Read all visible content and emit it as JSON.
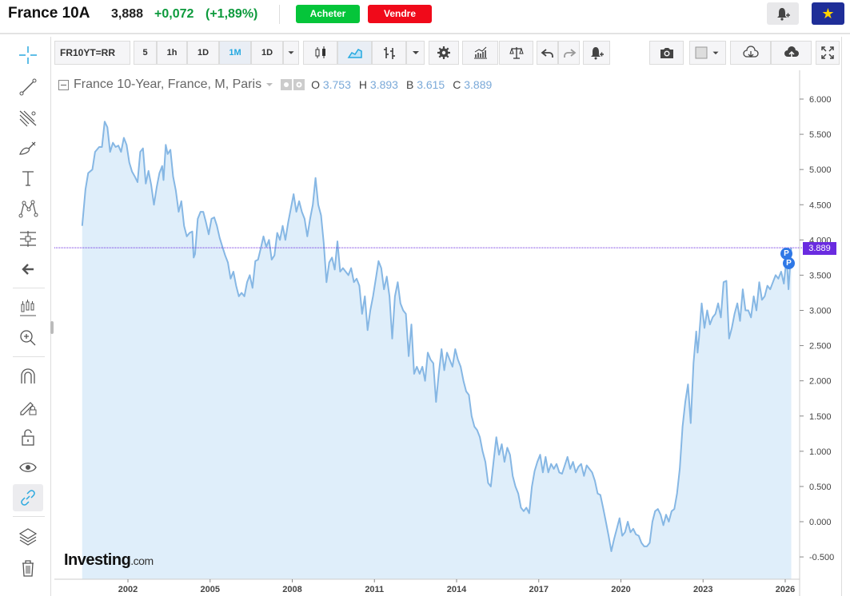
{
  "header": {
    "title": "France 10A",
    "price": "3,888",
    "change": "+0,072",
    "change_pct": "(+1,89%)",
    "buy_label": "Acheter",
    "sell_label": "Vendre",
    "colors": {
      "up": "#0c9a3c",
      "buy": "#05c53a",
      "sell": "#f00a1a",
      "watch": "#1f2e98"
    }
  },
  "left_toolbar": [
    {
      "name": "crosshair-icon",
      "active": false
    },
    {
      "name": "trend-line-icon",
      "active": false
    },
    {
      "name": "fib-tool-icon",
      "active": false
    },
    {
      "name": "brush-icon",
      "active": false
    },
    {
      "name": "text-icon",
      "active": false
    },
    {
      "name": "pattern-icon",
      "active": false
    },
    {
      "name": "measure-icon",
      "active": false
    },
    {
      "name": "back-arrow-icon",
      "active": false
    },
    {
      "name": "indicators-icon",
      "active": false
    },
    {
      "name": "zoom-in-icon",
      "active": false
    },
    {
      "name": "magnet-icon",
      "active": false
    },
    {
      "name": "lock-drawing-icon",
      "active": false
    },
    {
      "name": "unlock-icon",
      "active": false
    },
    {
      "name": "eye-icon",
      "active": false
    },
    {
      "name": "link-icon",
      "active": true
    },
    {
      "name": "layers-icon",
      "active": false
    },
    {
      "name": "trash-icon",
      "active": false
    }
  ],
  "top_toolbar": {
    "symbol": "FR10YT=RR",
    "intervals": [
      "5",
      "1h",
      "1D",
      "1M",
      "1D"
    ],
    "active_interval": "1M",
    "icons": [
      "candles-icon",
      "area-chart-icon",
      "bars-icon",
      "dropdown-icon",
      "settings-icon",
      "indicators-icon",
      "compare-icon",
      "undo-icon",
      "redo-icon",
      "alert-add-icon",
      "camera-icon",
      "color-box-icon",
      "cloud-download-icon",
      "cloud-upload-icon",
      "fullscreen-icon"
    ]
  },
  "legend": {
    "name": "France 10-Year, France, M, Paris",
    "o_label": "O",
    "o": "3.753",
    "h_label": "H",
    "h": "3.893",
    "l_label": "B",
    "l": "3.615",
    "c_label": "C",
    "c": "3.889"
  },
  "watermark": {
    "brand": "Investing",
    "suffix": ".com"
  },
  "markers": [
    "P",
    "P"
  ],
  "chart_data": {
    "type": "area",
    "title": "France 10-Year, France, M, Paris",
    "xlabel": "",
    "ylabel": "",
    "x_ticks": [
      "2002",
      "2005",
      "2008",
      "2011",
      "2014",
      "2017",
      "2020",
      "2023",
      "2026"
    ],
    "y_ticks": [
      "6.000",
      "5.500",
      "5.000",
      "4.500",
      "4.000",
      "3.500",
      "3.000",
      "2.500",
      "2.000",
      "1.500",
      "1.000",
      "0.500",
      "0.000",
      "-0.500"
    ],
    "ylim": [
      -0.8,
      6.3
    ],
    "xlim": [
      2000.3,
      2026.3
    ],
    "last_value": "3.889",
    "grid": false,
    "line_color": "#86b7e4",
    "fill_color": "#dfeefa",
    "last_line_color": "#6a2be0",
    "series": [
      {
        "values": [
          [
            2000.33,
            4.2
          ],
          [
            2000.45,
            4.72
          ],
          [
            2000.55,
            4.95
          ],
          [
            2000.7,
            5.0
          ],
          [
            2000.8,
            5.25
          ],
          [
            2000.95,
            5.32
          ],
          [
            2001.05,
            5.32
          ],
          [
            2001.15,
            5.68
          ],
          [
            2001.25,
            5.6
          ],
          [
            2001.35,
            5.25
          ],
          [
            2001.45,
            5.38
          ],
          [
            2001.55,
            5.32
          ],
          [
            2001.65,
            5.34
          ],
          [
            2001.75,
            5.25
          ],
          [
            2001.85,
            5.45
          ],
          [
            2001.95,
            5.35
          ],
          [
            2002.05,
            5.1
          ],
          [
            2002.15,
            4.97
          ],
          [
            2002.25,
            4.9
          ],
          [
            2002.35,
            4.82
          ],
          [
            2002.45,
            5.25
          ],
          [
            2002.55,
            5.3
          ],
          [
            2002.65,
            4.8
          ],
          [
            2002.75,
            4.98
          ],
          [
            2002.85,
            4.78
          ],
          [
            2002.95,
            4.5
          ],
          [
            2003.05,
            4.75
          ],
          [
            2003.15,
            4.95
          ],
          [
            2003.25,
            5.05
          ],
          [
            2003.3,
            4.85
          ],
          [
            2003.38,
            5.35
          ],
          [
            2003.45,
            5.22
          ],
          [
            2003.55,
            5.28
          ],
          [
            2003.65,
            4.9
          ],
          [
            2003.75,
            4.7
          ],
          [
            2003.85,
            4.4
          ],
          [
            2003.95,
            4.55
          ],
          [
            2004.05,
            4.2
          ],
          [
            2004.15,
            4.05
          ],
          [
            2004.25,
            4.1
          ],
          [
            2004.35,
            4.12
          ],
          [
            2004.4,
            3.75
          ],
          [
            2004.45,
            3.8
          ],
          [
            2004.55,
            4.3
          ],
          [
            2004.65,
            4.4
          ],
          [
            2004.75,
            4.4
          ],
          [
            2004.85,
            4.25
          ],
          [
            2004.95,
            4.08
          ],
          [
            2005.05,
            4.3
          ],
          [
            2005.15,
            4.32
          ],
          [
            2005.25,
            4.2
          ],
          [
            2005.35,
            4.03
          ],
          [
            2005.45,
            3.9
          ],
          [
            2005.55,
            3.78
          ],
          [
            2005.65,
            3.68
          ],
          [
            2005.75,
            3.45
          ],
          [
            2005.85,
            3.55
          ],
          [
            2005.95,
            3.35
          ],
          [
            2006.05,
            3.2
          ],
          [
            2006.15,
            3.25
          ],
          [
            2006.25,
            3.2
          ],
          [
            2006.35,
            3.4
          ],
          [
            2006.45,
            3.5
          ],
          [
            2006.55,
            3.32
          ],
          [
            2006.65,
            3.7
          ],
          [
            2006.75,
            3.72
          ],
          [
            2006.85,
            3.88
          ],
          [
            2006.95,
            4.05
          ],
          [
            2007.05,
            3.9
          ],
          [
            2007.15,
            4.0
          ],
          [
            2007.25,
            3.72
          ],
          [
            2007.35,
            3.78
          ],
          [
            2007.45,
            4.1
          ],
          [
            2007.55,
            4.0
          ],
          [
            2007.65,
            4.2
          ],
          [
            2007.75,
            4.0
          ],
          [
            2007.85,
            4.25
          ],
          [
            2007.95,
            4.45
          ],
          [
            2008.05,
            4.65
          ],
          [
            2008.15,
            4.4
          ],
          [
            2008.25,
            4.55
          ],
          [
            2008.35,
            4.4
          ],
          [
            2008.45,
            4.3
          ],
          [
            2008.55,
            4.05
          ],
          [
            2008.65,
            4.3
          ],
          [
            2008.75,
            4.5
          ],
          [
            2008.85,
            4.88
          ],
          [
            2008.95,
            4.5
          ],
          [
            2009.05,
            4.35
          ],
          [
            2009.15,
            3.95
          ],
          [
            2009.25,
            3.4
          ],
          [
            2009.35,
            3.68
          ],
          [
            2009.45,
            3.75
          ],
          [
            2009.55,
            3.58
          ],
          [
            2009.65,
            3.98
          ],
          [
            2009.75,
            3.55
          ],
          [
            2009.85,
            3.6
          ],
          [
            2009.95,
            3.55
          ],
          [
            2010.05,
            3.5
          ],
          [
            2010.15,
            3.6
          ],
          [
            2010.25,
            3.4
          ],
          [
            2010.35,
            3.45
          ],
          [
            2010.45,
            3.35
          ],
          [
            2010.55,
            2.95
          ],
          [
            2010.65,
            3.2
          ],
          [
            2010.75,
            2.72
          ],
          [
            2010.85,
            3.0
          ],
          [
            2010.95,
            3.2
          ],
          [
            2011.05,
            3.45
          ],
          [
            2011.15,
            3.7
          ],
          [
            2011.25,
            3.6
          ],
          [
            2011.35,
            3.3
          ],
          [
            2011.45,
            3.48
          ],
          [
            2011.55,
            3.2
          ],
          [
            2011.65,
            2.6
          ],
          [
            2011.75,
            3.2
          ],
          [
            2011.85,
            3.4
          ],
          [
            2011.95,
            3.1
          ],
          [
            2012.05,
            3.0
          ],
          [
            2012.15,
            2.95
          ],
          [
            2012.25,
            2.35
          ],
          [
            2012.35,
            2.8
          ],
          [
            2012.45,
            2.1
          ],
          [
            2012.55,
            2.2
          ],
          [
            2012.65,
            2.1
          ],
          [
            2012.75,
            2.2
          ],
          [
            2012.85,
            2.0
          ],
          [
            2012.95,
            2.4
          ],
          [
            2013.05,
            2.3
          ],
          [
            2013.15,
            2.25
          ],
          [
            2013.25,
            1.7
          ],
          [
            2013.35,
            2.1
          ],
          [
            2013.45,
            2.45
          ],
          [
            2013.55,
            2.15
          ],
          [
            2013.65,
            2.4
          ],
          [
            2013.75,
            2.3
          ],
          [
            2013.85,
            2.2
          ],
          [
            2013.95,
            2.45
          ],
          [
            2014.05,
            2.3
          ],
          [
            2014.15,
            2.2
          ],
          [
            2014.25,
            2.0
          ],
          [
            2014.35,
            1.85
          ],
          [
            2014.45,
            1.8
          ],
          [
            2014.55,
            1.5
          ],
          [
            2014.65,
            1.35
          ],
          [
            2014.75,
            1.3
          ],
          [
            2014.85,
            1.2
          ],
          [
            2014.95,
            1.0
          ],
          [
            2015.05,
            0.85
          ],
          [
            2015.15,
            0.55
          ],
          [
            2015.25,
            0.5
          ],
          [
            2015.35,
            0.85
          ],
          [
            2015.45,
            1.2
          ],
          [
            2015.55,
            0.95
          ],
          [
            2015.65,
            1.1
          ],
          [
            2015.75,
            0.85
          ],
          [
            2015.85,
            1.05
          ],
          [
            2015.95,
            0.95
          ],
          [
            2016.05,
            0.65
          ],
          [
            2016.15,
            0.5
          ],
          [
            2016.25,
            0.4
          ],
          [
            2016.35,
            0.2
          ],
          [
            2016.45,
            0.15
          ],
          [
            2016.55,
            0.2
          ],
          [
            2016.65,
            0.12
          ],
          [
            2016.75,
            0.5
          ],
          [
            2016.85,
            0.72
          ],
          [
            2016.95,
            0.85
          ],
          [
            2017.05,
            0.95
          ],
          [
            2017.15,
            0.7
          ],
          [
            2017.25,
            0.92
          ],
          [
            2017.35,
            0.7
          ],
          [
            2017.45,
            0.82
          ],
          [
            2017.55,
            0.75
          ],
          [
            2017.65,
            0.82
          ],
          [
            2017.75,
            0.7
          ],
          [
            2017.85,
            0.68
          ],
          [
            2017.95,
            0.8
          ],
          [
            2018.05,
            0.92
          ],
          [
            2018.15,
            0.75
          ],
          [
            2018.25,
            0.85
          ],
          [
            2018.35,
            0.7
          ],
          [
            2018.45,
            0.78
          ],
          [
            2018.55,
            0.82
          ],
          [
            2018.65,
            0.65
          ],
          [
            2018.75,
            0.8
          ],
          [
            2018.85,
            0.75
          ],
          [
            2018.95,
            0.7
          ],
          [
            2019.05,
            0.58
          ],
          [
            2019.15,
            0.4
          ],
          [
            2019.25,
            0.38
          ],
          [
            2019.35,
            0.2
          ],
          [
            2019.45,
            0.0
          ],
          [
            2019.55,
            -0.2
          ],
          [
            2019.65,
            -0.42
          ],
          [
            2019.75,
            -0.25
          ],
          [
            2019.85,
            -0.1
          ],
          [
            2019.95,
            0.05
          ],
          [
            2020.05,
            -0.2
          ],
          [
            2020.15,
            -0.15
          ],
          [
            2020.25,
            0.0
          ],
          [
            2020.35,
            -0.15
          ],
          [
            2020.45,
            -0.1
          ],
          [
            2020.55,
            -0.18
          ],
          [
            2020.65,
            -0.2
          ],
          [
            2020.75,
            -0.3
          ],
          [
            2020.85,
            -0.35
          ],
          [
            2020.95,
            -0.35
          ],
          [
            2021.05,
            -0.3
          ],
          [
            2021.15,
            0.0
          ],
          [
            2021.25,
            0.15
          ],
          [
            2021.35,
            0.18
          ],
          [
            2021.45,
            0.1
          ],
          [
            2021.55,
            -0.05
          ],
          [
            2021.65,
            0.1
          ],
          [
            2021.75,
            0.0
          ],
          [
            2021.85,
            0.15
          ],
          [
            2021.95,
            0.18
          ],
          [
            2022.05,
            0.4
          ],
          [
            2022.15,
            0.75
          ],
          [
            2022.25,
            1.35
          ],
          [
            2022.35,
            1.7
          ],
          [
            2022.45,
            1.95
          ],
          [
            2022.55,
            1.4
          ],
          [
            2022.65,
            2.25
          ],
          [
            2022.75,
            2.7
          ],
          [
            2022.8,
            2.4
          ],
          [
            2022.85,
            2.6
          ],
          [
            2022.95,
            3.1
          ],
          [
            2023.05,
            2.75
          ],
          [
            2023.15,
            3.0
          ],
          [
            2023.25,
            2.8
          ],
          [
            2023.35,
            2.9
          ],
          [
            2023.45,
            2.95
          ],
          [
            2023.55,
            3.1
          ],
          [
            2023.65,
            2.9
          ],
          [
            2023.75,
            3.4
          ],
          [
            2023.85,
            3.42
          ],
          [
            2023.95,
            2.6
          ],
          [
            2024.05,
            2.75
          ],
          [
            2024.15,
            2.95
          ],
          [
            2024.25,
            3.1
          ],
          [
            2024.35,
            2.85
          ],
          [
            2024.45,
            3.3
          ],
          [
            2024.55,
            3.0
          ],
          [
            2024.65,
            3.0
          ],
          [
            2024.75,
            2.9
          ],
          [
            2024.85,
            3.2
          ],
          [
            2024.95,
            3.0
          ],
          [
            2025.05,
            3.4
          ],
          [
            2025.15,
            3.15
          ],
          [
            2025.25,
            3.2
          ],
          [
            2025.35,
            3.35
          ],
          [
            2025.45,
            3.3
          ],
          [
            2025.55,
            3.4
          ],
          [
            2025.65,
            3.5
          ],
          [
            2025.75,
            3.45
          ],
          [
            2025.85,
            3.55
          ],
          [
            2025.95,
            3.38
          ],
          [
            2026.05,
            3.75
          ],
          [
            2026.12,
            3.3
          ],
          [
            2026.22,
            3.889
          ]
        ]
      }
    ]
  }
}
